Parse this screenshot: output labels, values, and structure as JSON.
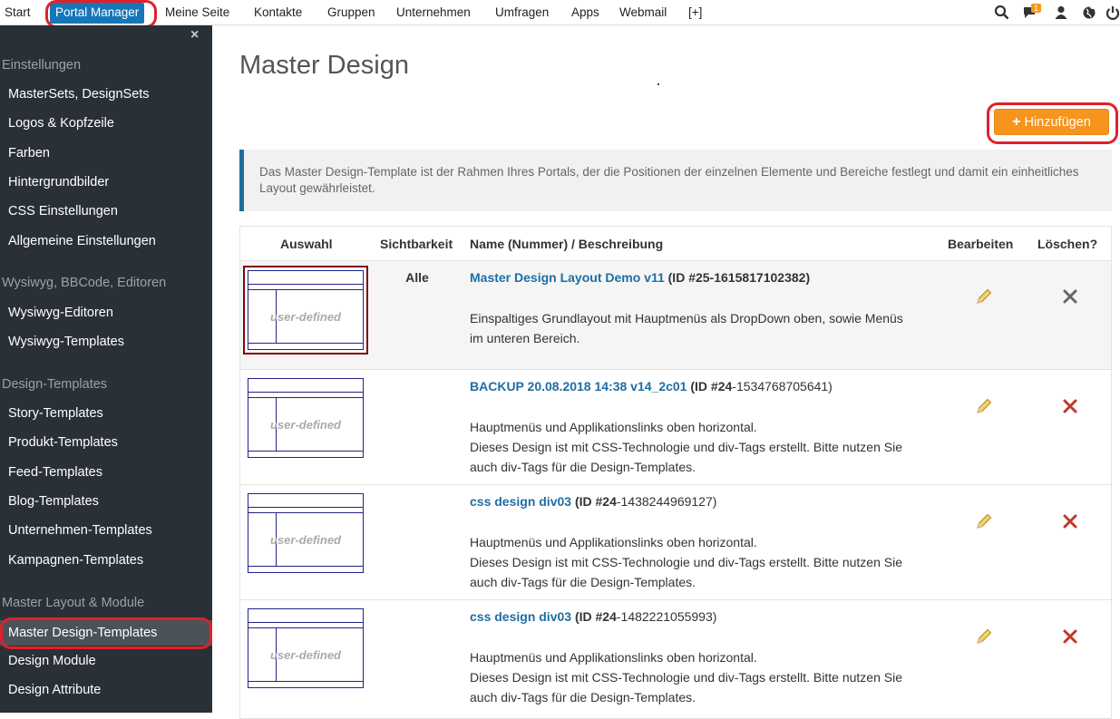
{
  "topnav": {
    "items": [
      "Start",
      "Portal Manager",
      "Meine Seite",
      "Kontakte",
      "Gruppen",
      "Unternehmen",
      "Umfragen",
      "Apps",
      "Webmail",
      "[+]"
    ],
    "badge_count": "1"
  },
  "sidebar": {
    "close": "×",
    "groups": [
      {
        "label": "Einstellungen",
        "items": [
          "MasterSets, DesignSets",
          "Logos & Kopfzeile",
          "Farben",
          "Hintergrundbilder",
          "CSS Einstellungen",
          "Allgemeine Einstellungen"
        ]
      },
      {
        "label": "Wysiwyg, BBCode, Editoren",
        "items": [
          "Wysiwyg-Editoren",
          "Wysiwyg-Templates"
        ]
      },
      {
        "label": "Design-Templates",
        "items": [
          "Story-Templates",
          "Produkt-Templates",
          "Feed-Templates",
          "Blog-Templates",
          "Unternehmen-Templates",
          "Kampagnen-Templates"
        ]
      },
      {
        "label": "Master Layout & Module",
        "items": [
          "Master Design-Templates",
          "Design Module",
          "Design Attribute"
        ]
      }
    ]
  },
  "main": {
    "title": "Master Design",
    "add_button": "Hinzufügen",
    "info": "Das Master Design-Template ist der Rahmen Ihres Portals, der die Positionen der einzelnen Elemente und Bereiche festlegt und damit ein einheitliches Layout gewährleistet.",
    "columns": [
      "Auswahl",
      "Sichtbarkeit",
      "Name (Nummer) / Beschreibung",
      "Bearbeiten",
      "Löschen?"
    ],
    "thumb_label": "user-defined",
    "rows": [
      {
        "visibility": "Alle",
        "name": "Master Design Layout Demo v11",
        "id_prefix": "(ID #25-",
        "id_rest": "1615817102382)",
        "desc": [
          "Einspaltiges Grundlayout mit Hauptmenüs als DropDown oben, sowie Menüs",
          "im unteren Bereich."
        ]
      },
      {
        "visibility": "",
        "name": "BACKUP 20.08.2018 14:38 v14_2c01",
        "id_prefix": "(ID #24",
        "id_rest": "-1534768705641)",
        "desc": [
          "Hauptmenüs und Applikationslinks oben horizontal.",
          "Dieses Design ist mit CSS-Technologie und div-Tags erstellt. Bitte nutzen Sie",
          "auch div-Tags für die Design-Templates."
        ]
      },
      {
        "visibility": "",
        "name": "css design div03",
        "id_prefix": "(ID #24",
        "id_rest": "-1438244969127)",
        "desc": [
          "Hauptmenüs und Applikationslinks oben horizontal.",
          "Dieses Design ist mit CSS-Technologie und div-Tags erstellt. Bitte nutzen Sie",
          "auch div-Tags für die Design-Templates."
        ]
      },
      {
        "visibility": "",
        "name": "css design div03",
        "id_prefix": "(ID #24",
        "id_rest": "-1482221055993)",
        "desc": [
          "Hauptmenüs und Applikationslinks oben horizontal.",
          "Dieses Design ist mit CSS-Technologie und div-Tags erstellt. Bitte nutzen Sie",
          "auch div-Tags für die Design-Templates."
        ]
      }
    ]
  },
  "colors": {
    "active_nav": "#1577b8",
    "sidebar_bg": "#2a3037",
    "accent": "#f7941d",
    "link": "#1f6ea3",
    "delete": "#c0392b",
    "highlight": "#e0202a"
  },
  "icons": [
    "search-icon",
    "chat-icon",
    "user-icon",
    "globe-icon",
    "power-icon",
    "pencil-icon",
    "delete-x-icon"
  ]
}
